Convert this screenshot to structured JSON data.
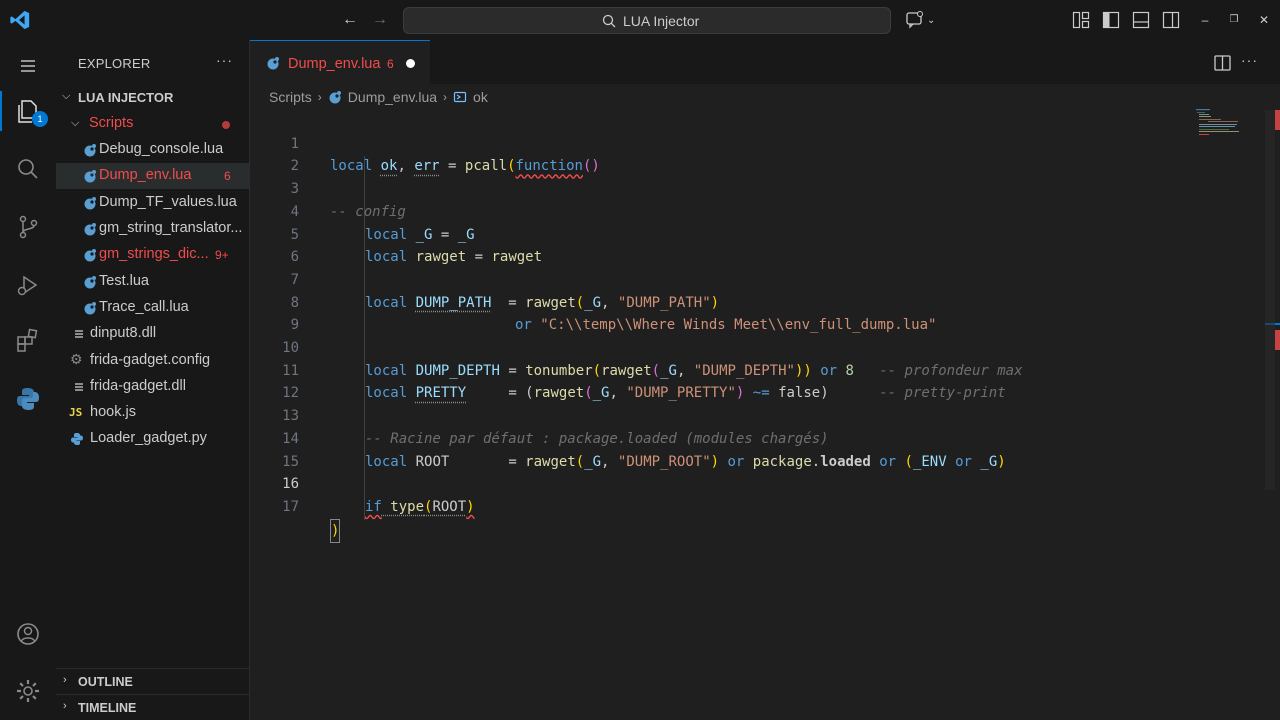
{
  "titlebar": {
    "search_text": "LUA Injector"
  },
  "activity": {
    "explorer_badge": "1"
  },
  "sidebar": {
    "title": "EXPLORER",
    "more": "···",
    "project": "LUA INJECTOR",
    "folder": "Scripts",
    "items": [
      {
        "name": "Debug_console.lua",
        "badge": ""
      },
      {
        "name": "Dump_env.lua",
        "badge": "6"
      },
      {
        "name": "Dump_TF_values.lua",
        "badge": ""
      },
      {
        "name": "gm_string_translator...",
        "badge": ""
      },
      {
        "name": "gm_strings_dic...",
        "badge": "9+"
      },
      {
        "name": "Test.lua",
        "badge": ""
      },
      {
        "name": "Trace_call.lua",
        "badge": ""
      },
      {
        "name": "dinput8.dll",
        "badge": ""
      },
      {
        "name": "frida-gadget.config",
        "badge": ""
      },
      {
        "name": "frida-gadget.dll",
        "badge": ""
      },
      {
        "name": "hook.js",
        "badge": ""
      },
      {
        "name": "Loader_gadget.py",
        "badge": ""
      }
    ],
    "outline": "OUTLINE",
    "timeline": "TIMELINE"
  },
  "editor": {
    "tab_name": "Dump_env.lua",
    "tab_count": "6",
    "breadcrumb": [
      "Scripts",
      "Dump_env.lua",
      "ok"
    ],
    "line_numbers": [
      "1",
      "2",
      "3",
      "4",
      "5",
      "6",
      "7",
      "8",
      "9",
      "10",
      "11",
      "12",
      "13",
      "14",
      "15",
      "16",
      "17"
    ],
    "code": {
      "l1": [
        "local",
        "ok",
        ", ",
        "err",
        " = ",
        "pcall",
        "(",
        "function",
        "()"
      ],
      "l3": "-- config",
      "l4": [
        "local",
        "_G",
        " = ",
        "_G"
      ],
      "l5": [
        "local",
        "rawget",
        " = ",
        "rawget"
      ],
      "l7": [
        "local",
        "DUMP_PATH",
        "  = ",
        "rawget",
        "(",
        "_G",
        ", ",
        "\"DUMP_PATH\"",
        ")"
      ],
      "l8": [
        "or",
        "\"C:\\\\temp\\\\Where Winds Meet\\\\env_full_dump.lua\""
      ],
      "l10": [
        "local",
        "DUMP_DEPTH",
        " = ",
        "tonumber",
        "(",
        "rawget",
        "(",
        "_G",
        ", ",
        "\"DUMP_DEPTH\"",
        "))",
        " or ",
        "8",
        "   -- profondeur max"
      ],
      "l11": [
        "local",
        "PRETTY",
        "     = (",
        "rawget",
        "(",
        "_G",
        ", ",
        "\"DUMP_PRETTY\"",
        ") ",
        "~=",
        " false",
        ")",
        "      -- pretty-print"
      ],
      "l13": "-- Racine par défaut : package.loaded (modules chargés)",
      "l14": [
        "local",
        "ROOT",
        "       = ",
        "rawget",
        "(",
        "_G",
        ", ",
        "\"DUMP_ROOT\"",
        ") ",
        "or",
        " package",
        ".",
        "loaded",
        " or ",
        "(",
        "_ENV",
        " or ",
        "_G",
        ")"
      ],
      "l16": [
        "if",
        " type",
        "(",
        "ROOT",
        ")"
      ],
      "l17": ")"
    }
  },
  "colors": {
    "accent": "#0078d4",
    "error": "#f14c4c"
  }
}
